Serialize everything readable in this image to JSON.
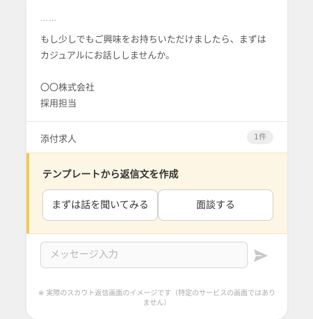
{
  "message": {
    "ellipsis": "……",
    "line1": "もし少しでもご興味をお持ちいただけましたら、まずは",
    "line2": "カジュアルにお話ししませんか。",
    "company": "〇〇株式会社",
    "role": "採用担当"
  },
  "attachment": {
    "label": "添付求人",
    "count": "1件"
  },
  "template": {
    "title": "テンプレートから返信文を作成",
    "options": [
      {
        "label": "まずは話を聞いてみる"
      },
      {
        "label": "面談する"
      }
    ]
  },
  "composer": {
    "placeholder": "メッセージ入力",
    "value": ""
  },
  "footer": {
    "note": "※ 実際のスカウト返信画面のイメージです（特定のサービスの画面ではありません）"
  },
  "colors": {
    "accent": "#f2c94c",
    "template_bg": "#fdf6e4",
    "send_icon": "#c7c7c7"
  }
}
